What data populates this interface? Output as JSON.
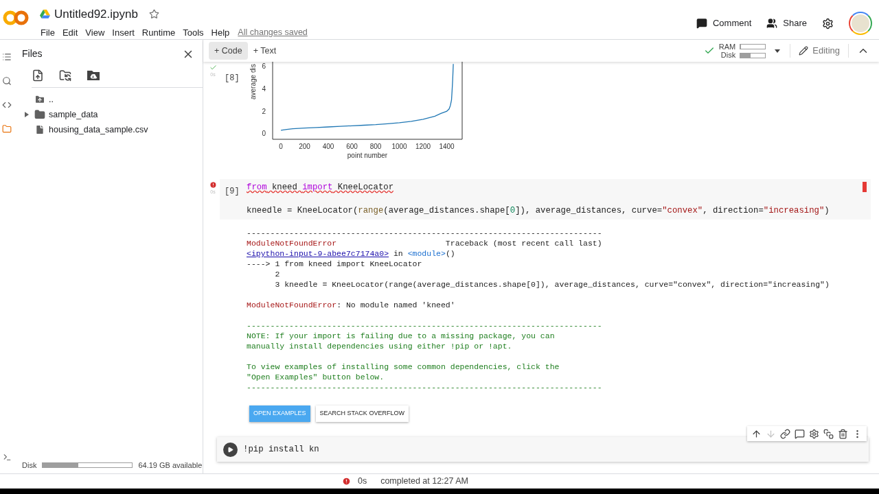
{
  "header": {
    "title": "Untitled92.ipynb",
    "menu": [
      "File",
      "Edit",
      "View",
      "Insert",
      "Runtime",
      "Tools",
      "Help"
    ],
    "save_status": "All changes saved",
    "actions": [
      {
        "label": "Comment"
      },
      {
        "label": "Share"
      }
    ]
  },
  "toolbar": {
    "add_buttons": [
      {
        "label": "+ Code",
        "hovered": true
      },
      {
        "label": "+ Text",
        "hovered": false
      }
    ],
    "resources": [
      {
        "label": "RAM",
        "level": 0.03
      },
      {
        "label": "Disk",
        "level": 0.4
      }
    ],
    "mode": "Editing"
  },
  "rail": [
    {
      "selected": false
    },
    {
      "selected": false
    },
    {
      "selected": false
    },
    {
      "selected": true
    }
  ],
  "files_panel": {
    "title": "Files",
    "tree": [
      {
        "kind": "parent",
        "name": ".."
      },
      {
        "kind": "folder",
        "name": "sample_data",
        "expanded": false
      },
      {
        "kind": "file",
        "name": "housing_data_sample.csv"
      }
    ],
    "disk": {
      "label": "Disk",
      "level": 0.4,
      "reading": "64.19 GB available"
    }
  },
  "cells": [
    {
      "kind": "chart",
      "exec": "[8]",
      "failed": false,
      "time": "0s",
      "chart_data": {
        "type": "line",
        "xlabel": "point number",
        "ylabel": "average dis",
        "x": [
          0,
          50,
          100,
          200,
          300,
          400,
          500,
          600,
          700,
          800,
          900,
          1000,
          1100,
          1200,
          1300,
          1350,
          1400,
          1420,
          1430,
          1440,
          1445,
          1450,
          1455
        ],
        "values": [
          0.3,
          0.38,
          0.44,
          0.5,
          0.55,
          0.6,
          0.65,
          0.7,
          0.75,
          0.8,
          0.88,
          0.97,
          1.1,
          1.28,
          1.55,
          1.8,
          2.0,
          2.2,
          2.5,
          3.0,
          3.8,
          4.8,
          6.2
        ],
        "xlim": [
          -70,
          1530
        ],
        "ylim": [
          -0.5,
          6.4
        ],
        "xticks": [
          0,
          200,
          400,
          600,
          800,
          1000,
          1200,
          1400
        ],
        "yticks": [
          0,
          2,
          4,
          6
        ]
      }
    },
    {
      "kind": "code",
      "exec": "[9]",
      "failed": true,
      "time": "0s",
      "code": [
        [
          {
            "squiggle": true,
            "segments": [
              {
                "kind": "keyword",
                "text": "from"
              },
              {
                "kind": "plain",
                "text": " kneed "
              },
              {
                "kind": "keyword",
                "text": "import"
              },
              {
                "kind": "plain",
                "text": " KneeLocator"
              }
            ]
          }
        ],
        [
          {
            "squiggle": false,
            "segments": [
              {
                "kind": "plain",
                "text": "kneedle = KneeLocator("
              },
              {
                "kind": "builtin",
                "text": "range"
              },
              {
                "kind": "plain",
                "text": "(average_distances.shape["
              },
              {
                "kind": "number",
                "text": "0"
              },
              {
                "kind": "plain",
                "text": "]), average_distances, curve="
              },
              {
                "kind": "string",
                "text": "\"convex\""
              },
              {
                "kind": "plain",
                "text": ", direction="
              },
              {
                "kind": "string",
                "text": "\"increasing\""
              },
              {
                "kind": "plain",
                "text": ")"
              }
            ]
          }
        ]
      ],
      "output": [
        [
          [
            {
              "kind": "plain",
              "text": "---------------------------------------------------------------------------"
            }
          ],
          [
            {
              "kind": "error",
              "text": "ModuleNotFoundError"
            },
            {
              "kind": "plain",
              "text": "                       Traceback (most recent call last)"
            }
          ],
          [
            {
              "kind": "link",
              "text": "<ipython-input-9-abee7c7174a0>"
            },
            {
              "kind": "plain",
              "text": " in "
            },
            {
              "kind": "module",
              "text": "<module>"
            },
            {
              "kind": "plain",
              "text": "()"
            }
          ],
          [
            {
              "kind": "plain",
              "text": "----> 1 from kneed import KneeLocator"
            }
          ],
          [
            {
              "kind": "plain",
              "text": "      2"
            }
          ],
          [
            {
              "kind": "plain",
              "text": "      3 kneedle = KneeLocator(range(average_distances.shape[0]), average_distances, curve=\"convex\", direction=\"increasing\")"
            }
          ]
        ],
        [
          [
            {
              "kind": "error",
              "text": "ModuleNotFoundError"
            },
            {
              "kind": "plain",
              "text": ": No module named 'kneed'"
            }
          ]
        ],
        [
          [
            {
              "kind": "note",
              "text": "---------------------------------------------------------------------------"
            }
          ],
          [
            {
              "kind": "note",
              "text": "NOTE: If your import is failing due to a missing package, you can"
            }
          ],
          [
            {
              "kind": "note",
              "text": "manually install dependencies using either !pip or !apt."
            }
          ]
        ],
        [
          [
            {
              "kind": "note",
              "text": "To view examples of installing some common dependencies, click the"
            }
          ],
          [
            {
              "kind": "note",
              "text": "\"Open Examples\" button below."
            }
          ],
          [
            {
              "kind": "note",
              "text": "---------------------------------------------------------------------------"
            }
          ]
        ]
      ],
      "buttons": [
        {
          "label": "OPEN EXAMPLES",
          "primary": true
        },
        {
          "label": "SEARCH STACK OVERFLOW",
          "primary": false
        }
      ]
    },
    {
      "kind": "input",
      "code": "!pip install kn",
      "toolbar": [
        {
          "disabled": false
        },
        {
          "disabled": true
        },
        {
          "disabled": false
        },
        {
          "disabled": false
        },
        {
          "disabled": false
        },
        {
          "disabled": false
        },
        {
          "disabled": false
        },
        {
          "disabled": false
        }
      ]
    }
  ],
  "status_bar": {
    "time": "0s",
    "message": "completed at 12:27 AM"
  }
}
